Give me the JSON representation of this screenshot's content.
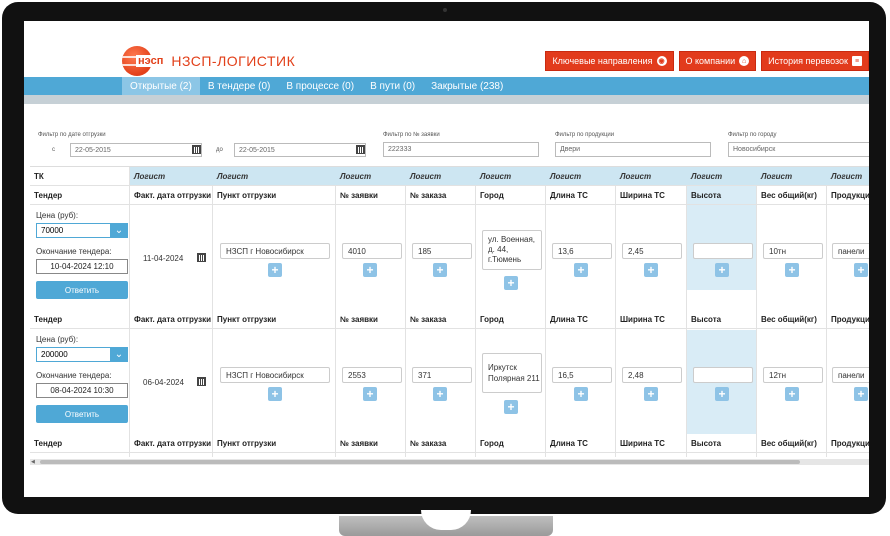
{
  "brand": {
    "mark": "нэсп",
    "name": "НЗСП-ЛОГИСТИК"
  },
  "top_buttons": [
    {
      "label": "Ключевые направления",
      "icon": "globe-icon",
      "glyph": "◉"
    },
    {
      "label": "О компании",
      "icon": "home-icon",
      "glyph": "⌂"
    },
    {
      "label": "История перевозок",
      "icon": "list-icon",
      "glyph": "≡"
    }
  ],
  "nav_tabs": [
    {
      "label": "Открытые (2)",
      "active": true
    },
    {
      "label": "В тендере (0)"
    },
    {
      "label": "В процессе (0)"
    },
    {
      "label": "В пути (0)"
    },
    {
      "label": "Закрытые (238)"
    }
  ],
  "filters": {
    "date_label": "Фильтр по дате отгрузки",
    "from_label": "с",
    "from_value": "22-05-2015",
    "to_label": "до",
    "to_value": "22-05-2015",
    "request_label": "Фильтр по № заявки",
    "request_value": "222333",
    "product_label": "Фильтр по продукции",
    "product_value": "Двери",
    "city_label": "Фильтр по городу",
    "city_value": "Новосибирск"
  },
  "columns": {
    "tk": "ТК",
    "logist": "Логист",
    "tender": "Тендер",
    "ship_date": "Факт. дата отгрузки",
    "ship_point": "Пункт отгрузки",
    "request_no": "№ заявки",
    "order_no": "№ заказа",
    "city": "Город",
    "length": "Длина ТС",
    "width": "Ширина ТС",
    "height": "Высота",
    "weight": "Вес общий(кг)",
    "product": "Продукция"
  },
  "tender_labels": {
    "price": "Цена (руб):",
    "end": "Окончание тендера:",
    "answer": "Ответить"
  },
  "rows": [
    {
      "price": "70000",
      "tender_end": "10-04-2024 12:10",
      "ship_date": "11-04-2024",
      "ship_point": "НЗСП г Новосибирск",
      "request_no": "4010",
      "order_no": "185",
      "city_line1": "ул. Военная,",
      "city_line2": "д. 44,",
      "city_line3": "г.Тюмень",
      "length": "13,6",
      "width": "2,45",
      "height": "",
      "weight": "10тн",
      "product": "панели"
    },
    {
      "price": "200000",
      "tender_end": "08-04-2024 10:30",
      "ship_date": "06-04-2024",
      "ship_point": "НЗСП г Новосибирск",
      "request_no": "2553",
      "order_no": "371",
      "city_line1": "Иркутск",
      "city_line2": "Полярная 211",
      "city_line3": "",
      "length": "16,5",
      "width": "2,48",
      "height": "",
      "weight": "12тн",
      "product": "панели"
    }
  ],
  "plus_glyph": "+",
  "dropdown_glyph": "⌄"
}
